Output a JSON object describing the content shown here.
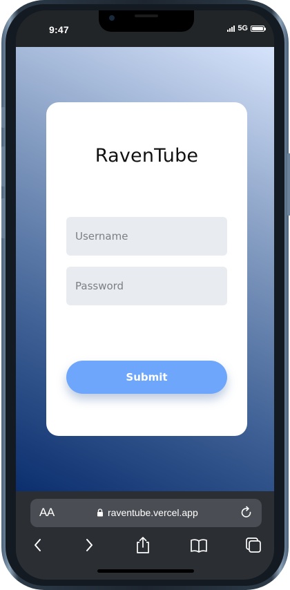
{
  "status_bar": {
    "time": "9:47",
    "network": "5G"
  },
  "page": {
    "app_title": "RavenTube",
    "username_placeholder": "Username",
    "password_placeholder": "Password",
    "submit_label": "Submit"
  },
  "browser": {
    "text_size_label": "AA",
    "url": "raventube.vercel.app"
  },
  "icons": {
    "status": [
      "signal-icon",
      "battery-icon"
    ],
    "url_bar": [
      "text-size-icon",
      "lock-icon",
      "reload-icon"
    ],
    "toolbar": [
      "back-icon",
      "forward-icon",
      "share-icon",
      "bookmarks-icon",
      "tabs-icon"
    ]
  },
  "colors": {
    "submit_button": "#6ea6fb",
    "input_background": "#e8ebef",
    "gradient_dark": "#0b2e6e",
    "gradient_light": "#d6e3fb"
  }
}
